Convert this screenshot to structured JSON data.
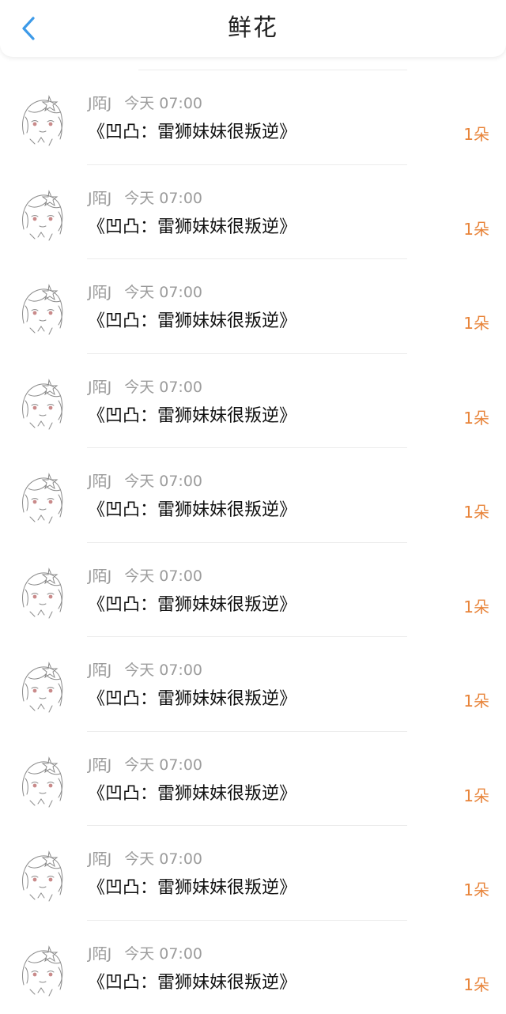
{
  "header": {
    "title": "鲜花"
  },
  "colors": {
    "accent_blue": "#3d9ae8",
    "count_orange": "#e8843a"
  },
  "items": [
    {
      "user": "J陌J",
      "time": "今天 07:00",
      "book": "《凹凸：雷狮妹妹很叛逆》",
      "count": "1朵"
    },
    {
      "user": "J陌J",
      "time": "今天 07:00",
      "book": "《凹凸：雷狮妹妹很叛逆》",
      "count": "1朵"
    },
    {
      "user": "J陌J",
      "time": "今天 07:00",
      "book": "《凹凸：雷狮妹妹很叛逆》",
      "count": "1朵"
    },
    {
      "user": "J陌J",
      "time": "今天 07:00",
      "book": "《凹凸：雷狮妹妹很叛逆》",
      "count": "1朵"
    },
    {
      "user": "J陌J",
      "time": "今天 07:00",
      "book": "《凹凸：雷狮妹妹很叛逆》",
      "count": "1朵"
    },
    {
      "user": "J陌J",
      "time": "今天 07:00",
      "book": "《凹凸：雷狮妹妹很叛逆》",
      "count": "1朵"
    },
    {
      "user": "J陌J",
      "time": "今天 07:00",
      "book": "《凹凸：雷狮妹妹很叛逆》",
      "count": "1朵"
    },
    {
      "user": "J陌J",
      "time": "今天 07:00",
      "book": "《凹凸：雷狮妹妹很叛逆》",
      "count": "1朵"
    },
    {
      "user": "J陌J",
      "time": "今天 07:00",
      "book": "《凹凸：雷狮妹妹很叛逆》",
      "count": "1朵"
    },
    {
      "user": "J陌J",
      "time": "今天 07:00",
      "book": "《凹凸：雷狮妹妹很叛逆》",
      "count": "1朵"
    }
  ]
}
